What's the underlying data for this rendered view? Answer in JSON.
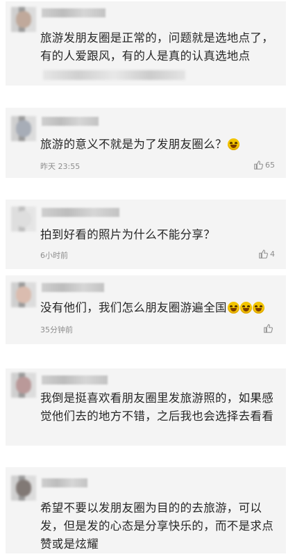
{
  "comments": [
    {
      "text": "旅游发朋友圈是正常的，问题就是选地点了，有的人爱跟风，有的人是真的认真选地点",
      "time": "",
      "likes": ""
    },
    {
      "text": "旅游的意义不就是为了发朋友圈么？",
      "emoji": "laughing-tears-emoji",
      "time": "昨天 23:55",
      "likes": "65"
    },
    {
      "text": "拍到好看的照片为什么不能分享？",
      "time": "6小时前",
      "likes": "4"
    },
    {
      "text": "没有他们，我们怎么朋友圈游遍全国",
      "emoji": "grinning-emoji",
      "time": "35分钟前",
      "likes": ""
    },
    {
      "text": "我倒是挺喜欢看朋友圈里发旅游照的，如果感觉他们去的地方不错，之后我也会选择去看看",
      "time": "",
      "likes": ""
    },
    {
      "text": "希望不要以发朋友圈为目的的去旅游，可以发，但是发的心态是分享快乐的，而不是求点赞或是炫耀",
      "time": "",
      "likes": ""
    }
  ],
  "icons": {
    "like": "thumbs-up-icon"
  },
  "colors": {
    "card_bg": "#f4f4f4",
    "text": "#262626",
    "meta": "#8d8d8d"
  }
}
